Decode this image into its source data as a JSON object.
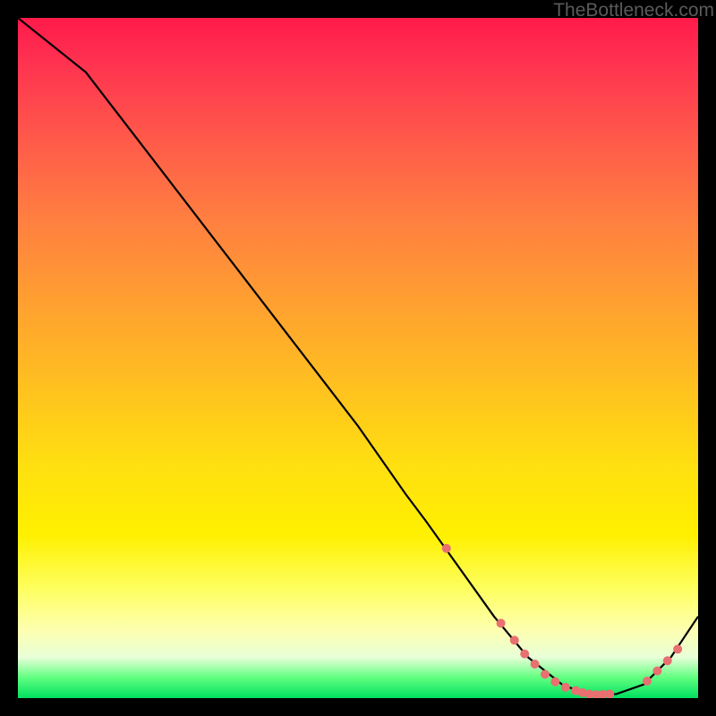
{
  "watermark": "TheBottleneck.com",
  "chart_data": {
    "type": "line",
    "title": "",
    "xlabel": "",
    "ylabel": "",
    "xlim": [
      0,
      100
    ],
    "ylim": [
      0,
      100
    ],
    "grid": false,
    "legend": false,
    "series": [
      {
        "name": "curve",
        "x": [
          0,
          10,
          20,
          30,
          40,
          50,
          57,
          60,
          65,
          70,
          75,
          80,
          83,
          85,
          88,
          92,
          96,
          100
        ],
        "y": [
          100,
          92,
          79,
          66,
          53,
          40,
          30,
          26,
          19,
          12,
          6,
          2,
          0.8,
          0.5,
          0.6,
          2,
          6,
          12
        ]
      }
    ],
    "dots": {
      "name": "highlighted-points",
      "color": "#e87070",
      "x": [
        63,
        71,
        73,
        74.5,
        76,
        77.5,
        79,
        80.5,
        82,
        83,
        84,
        85,
        86,
        87,
        92.5,
        94,
        95.5,
        97
      ],
      "y": [
        22,
        11,
        8.5,
        6.5,
        5,
        3.5,
        2.4,
        1.6,
        1.1,
        0.8,
        0.6,
        0.5,
        0.55,
        0.6,
        2.5,
        4,
        5.5,
        7.2
      ]
    },
    "background_gradient": {
      "stops": [
        {
          "pos": 0,
          "color": "#ff1a4a"
        },
        {
          "pos": 50,
          "color": "#ffc020"
        },
        {
          "pos": 80,
          "color": "#feff60"
        },
        {
          "pos": 97,
          "color": "#60ff80"
        },
        {
          "pos": 100,
          "color": "#00e060"
        }
      ]
    }
  }
}
